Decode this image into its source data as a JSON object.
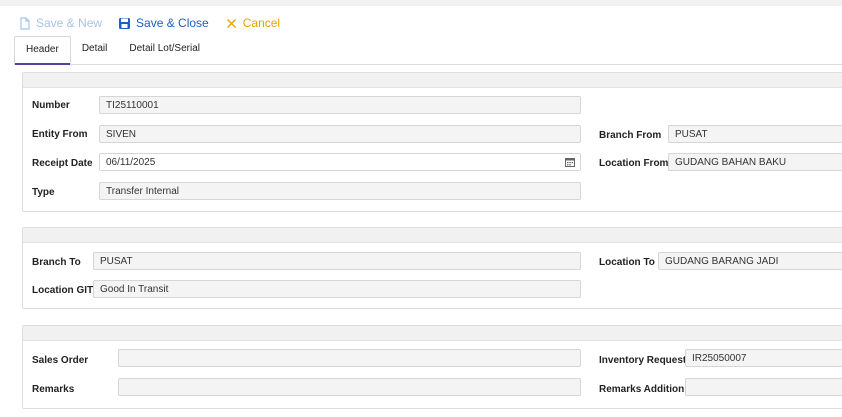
{
  "toolbar": {
    "save_new": "Save & New",
    "save_close": "Save & Close",
    "cancel": "Cancel",
    "save_new_icon": "document-icon",
    "save_close_icon": "floppy-disk-icon",
    "cancel_icon": "close-icon"
  },
  "tabs": [
    {
      "label": "Header",
      "active": true
    },
    {
      "label": "Detail",
      "active": false
    },
    {
      "label": "Detail Lot/Serial",
      "active": false
    }
  ],
  "section1": {
    "number": {
      "label": "Number",
      "value": "TI25110001"
    },
    "entity_from": {
      "label": "Entity From",
      "value": "SIVEN"
    },
    "receipt_date": {
      "label": "Receipt Date",
      "value": "06/11/2025"
    },
    "type": {
      "label": "Type",
      "value": "Transfer Internal"
    },
    "branch_from": {
      "label": "Branch From",
      "value": "PUSAT"
    },
    "location_from": {
      "label": "Location From",
      "value": "GUDANG BAHAN BAKU"
    }
  },
  "section2": {
    "branch_to": {
      "label": "Branch To",
      "value": "PUSAT"
    },
    "location_git": {
      "label": "Location GIT",
      "value": "Good In Transit"
    },
    "location_to": {
      "label": "Location To",
      "value": "GUDANG BARANG JADI"
    }
  },
  "section3": {
    "sales_order": {
      "label": "Sales Order",
      "value": ""
    },
    "remarks": {
      "label": "Remarks",
      "value": ""
    },
    "inventory_request": {
      "label": "Inventory Request",
      "value": "IR25050007"
    },
    "remarks_addition": {
      "label": "Remarks Addition",
      "value": ""
    }
  },
  "colors": {
    "primary": "#1f5fbf",
    "disabled": "#a8c3e8",
    "cancel": "#e8a100",
    "tab_underline": "#5b3d9c"
  }
}
